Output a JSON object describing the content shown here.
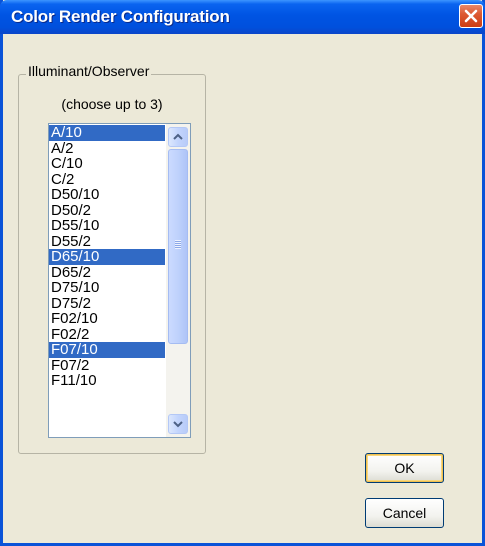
{
  "window": {
    "title": "Color Render Configuration"
  },
  "group": {
    "label": "Illuminant/Observer",
    "hint": "(choose up to 3)"
  },
  "list": {
    "items": [
      {
        "label": "A/10",
        "selected": true
      },
      {
        "label": "A/2",
        "selected": false
      },
      {
        "label": "C/10",
        "selected": false
      },
      {
        "label": "C/2",
        "selected": false
      },
      {
        "label": "D50/10",
        "selected": false
      },
      {
        "label": "D50/2",
        "selected": false
      },
      {
        "label": "D55/10",
        "selected": false
      },
      {
        "label": "D55/2",
        "selected": false
      },
      {
        "label": "D65/10",
        "selected": true
      },
      {
        "label": "D65/2",
        "selected": false
      },
      {
        "label": "D75/10",
        "selected": false
      },
      {
        "label": "D75/2",
        "selected": false
      },
      {
        "label": "F02/10",
        "selected": false
      },
      {
        "label": "F02/2",
        "selected": false
      },
      {
        "label": "F07/10",
        "selected": true
      },
      {
        "label": "F07/2",
        "selected": false
      },
      {
        "label": "F11/10",
        "selected": false
      }
    ]
  },
  "buttons": {
    "ok_label": "OK",
    "cancel_label": "Cancel"
  },
  "colors": {
    "title_bar": "#0054e3",
    "selection": "#316ac5",
    "dialog_bg": "#ece9d8",
    "close_button": "#dd5a33"
  },
  "icons": {
    "close": "close-icon",
    "scroll_up": "chevron-up-icon",
    "scroll_down": "chevron-down-icon"
  }
}
